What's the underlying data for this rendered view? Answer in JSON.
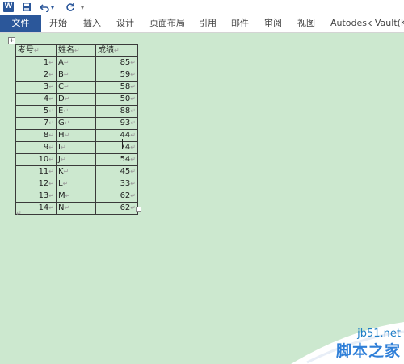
{
  "quick_access": {
    "save_icon": "save-icon",
    "undo_icon": "undo-icon",
    "redo_icon": "redo-icon"
  },
  "ribbon": {
    "tabs": [
      {
        "label": "文件"
      },
      {
        "label": "开始"
      },
      {
        "label": "插入"
      },
      {
        "label": "设计"
      },
      {
        "label": "页面布局"
      },
      {
        "label": "引用"
      },
      {
        "label": "邮件"
      },
      {
        "label": "审阅"
      },
      {
        "label": "视图"
      },
      {
        "label": "Autodesk Vault(K)"
      }
    ]
  },
  "table": {
    "headers": [
      "考号",
      "姓名",
      "成绩"
    ],
    "rows": [
      {
        "id": "1",
        "name": "A",
        "score": "85"
      },
      {
        "id": "2",
        "name": "B",
        "score": "59"
      },
      {
        "id": "3",
        "name": "C",
        "score": "58"
      },
      {
        "id": "4",
        "name": "D",
        "score": "50"
      },
      {
        "id": "5",
        "name": "E",
        "score": "88"
      },
      {
        "id": "7",
        "name": "G",
        "score": "93"
      },
      {
        "id": "8",
        "name": "H",
        "score": "44"
      },
      {
        "id": "9",
        "name": "I",
        "score": "74"
      },
      {
        "id": "10",
        "name": "J",
        "score": "54"
      },
      {
        "id": "11",
        "name": "K",
        "score": "45"
      },
      {
        "id": "12",
        "name": "L",
        "score": "33"
      },
      {
        "id": "13",
        "name": "M",
        "score": "62"
      },
      {
        "id": "14",
        "name": "N",
        "score": "62"
      }
    ]
  },
  "watermark": {
    "site": "jb51.net",
    "name": "脚本之家"
  },
  "colors": {
    "accent": "#2b579a",
    "page_background": "#cce8cf"
  }
}
